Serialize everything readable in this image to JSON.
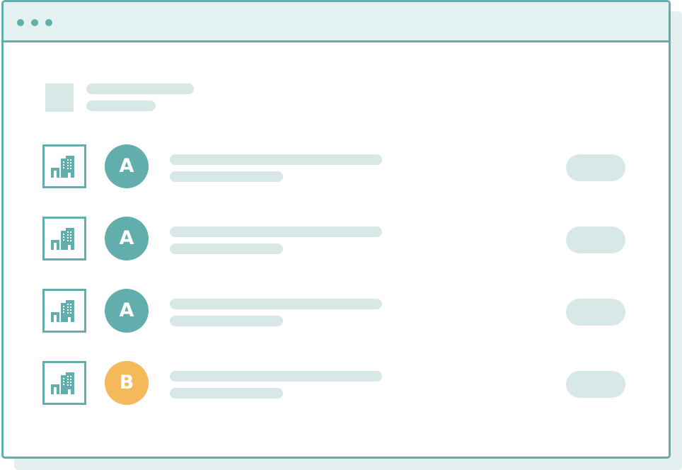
{
  "window": {
    "titlebar_dots": [
      "dot",
      "dot",
      "dot"
    ]
  },
  "colors": {
    "accent": "#62aeac",
    "titlebar_bg": "#e3f1f0",
    "placeholder": "#d8e8e6",
    "avatar_a": "#62aeac",
    "avatar_b": "#f5b85a"
  },
  "icons": {
    "row_icon": "building-icon",
    "header_icon": "image-placeholder-icon"
  },
  "rows": [
    {
      "avatar_letter": "A",
      "avatar_color": "#62aeac"
    },
    {
      "avatar_letter": "A",
      "avatar_color": "#62aeac"
    },
    {
      "avatar_letter": "A",
      "avatar_color": "#62aeac"
    },
    {
      "avatar_letter": "B",
      "avatar_color": "#f5b85a"
    }
  ]
}
